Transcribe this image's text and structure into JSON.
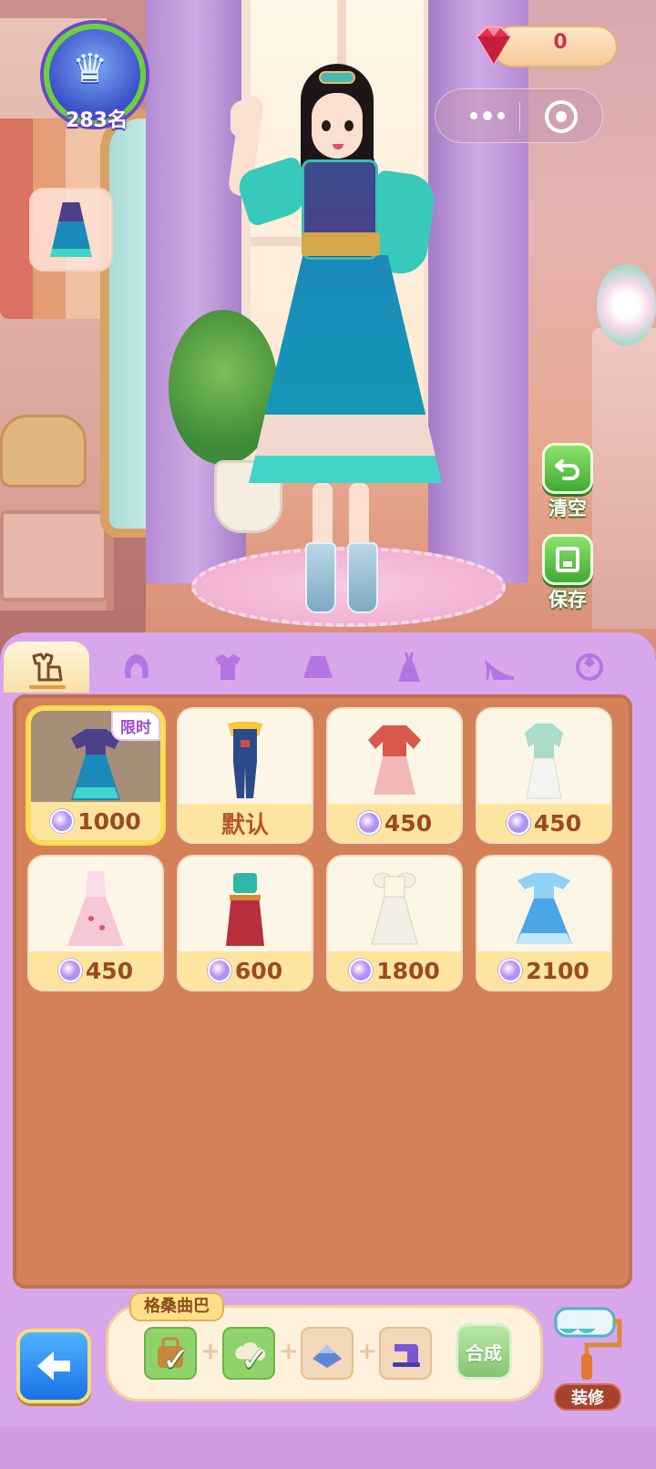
{
  "hud": {
    "rank_text": "283名",
    "gem_count": "0"
  },
  "actions": {
    "clear_label": "清空",
    "save_label": "保存"
  },
  "tabs": [
    {
      "id": "outfit-set",
      "icon": "outfit-set-icon",
      "active": true
    },
    {
      "id": "hair",
      "icon": "hair-icon",
      "active": false
    },
    {
      "id": "top",
      "icon": "shirt-icon",
      "active": false
    },
    {
      "id": "skirt",
      "icon": "skirt-icon",
      "active": false
    },
    {
      "id": "dress",
      "icon": "dress-icon",
      "active": false
    },
    {
      "id": "shoes",
      "icon": "high-heel-icon",
      "active": false
    },
    {
      "id": "accessory",
      "icon": "accessory-icon",
      "active": false
    }
  ],
  "items": [
    {
      "price": "1000",
      "tag": "限时",
      "selected": true,
      "palette": "#4e3f8a|#1a8ab9|#3fd6c8"
    },
    {
      "price": "默认",
      "palette": "#f6c83a|#2a4a8a|#233f78"
    },
    {
      "price": "450",
      "palette": "#d8594a|#f3b7b8|#f7d2d2"
    },
    {
      "price": "450",
      "palette": "#a9dcc9|#f4f4f0|#e8e8e2"
    },
    {
      "price": "450",
      "palette": "#f9dde6|#f6c9d6|#fbe6ec"
    },
    {
      "price": "600",
      "palette": "#2fb6a7|#b8303d|#d78a34"
    },
    {
      "price": "1800",
      "palette": "#fbf6e2|#f1efe6|#e8e2cf"
    },
    {
      "price": "2100",
      "palette": "#8fd2f7|#4aa6e6|#bfe6fb"
    }
  ],
  "recipe": {
    "title": "格桑曲巴",
    "synthesize_label": "合成",
    "slots": [
      {
        "icon": "bag-icon",
        "owned": true
      },
      {
        "icon": "cloud-scarf-icon",
        "owned": true
      },
      {
        "icon": "blue-stone-icon",
        "owned": false
      },
      {
        "icon": "sewing-machine-icon",
        "owned": false
      }
    ]
  },
  "decorate_label": "装修",
  "colors": {
    "panel": "#d8a6ea",
    "grid_bg": "#d4815a",
    "price_bar": "#fde5a0",
    "accent_green": "#3faa34",
    "gem_red": "#c8374a"
  }
}
